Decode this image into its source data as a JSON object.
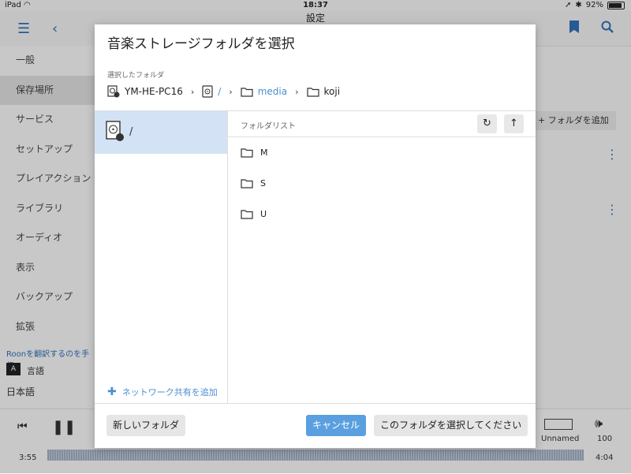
{
  "status_bar": {
    "device": "iPad",
    "time": "18:37",
    "battery": "92%"
  },
  "app_bar": {
    "title": "設定"
  },
  "sidebar": {
    "items": [
      {
        "label": "一般"
      },
      {
        "label": "保存場所"
      },
      {
        "label": "サービス"
      },
      {
        "label": "セットアップ"
      },
      {
        "label": "プレイアクション"
      },
      {
        "label": "ライブラリ"
      },
      {
        "label": "オーディオ"
      },
      {
        "label": "表示"
      },
      {
        "label": "バックアップ"
      },
      {
        "label": "拡張"
      }
    ],
    "active_index": 1,
    "translate_text": "Roonを翻訳するのを手伝",
    "language_label": "言語",
    "language_value": "日本語"
  },
  "background": {
    "add_folder_label": "フォルダを追加"
  },
  "player": {
    "elapsed": "3:55",
    "remaining": "4:04",
    "zone_name": "Unnamed",
    "volume": "100"
  },
  "dialog": {
    "title": "音楽ストレージフォルダを選択",
    "selected_label": "選択したフォルダ",
    "breadcrumb": {
      "host": "YM-HE-PC16",
      "root": "/",
      "folder1": "media",
      "folder2": "koji"
    },
    "left_panel": {
      "root_label": "/",
      "add_network_share": "ネットワーク共有を追加"
    },
    "folder_list": {
      "header": "フォルダリスト",
      "items": [
        "M",
        "S",
        "U"
      ]
    },
    "buttons": {
      "new_folder": "新しいフォルダ",
      "cancel": "キャンセル",
      "select": "このフォルダを選択してください"
    }
  }
}
